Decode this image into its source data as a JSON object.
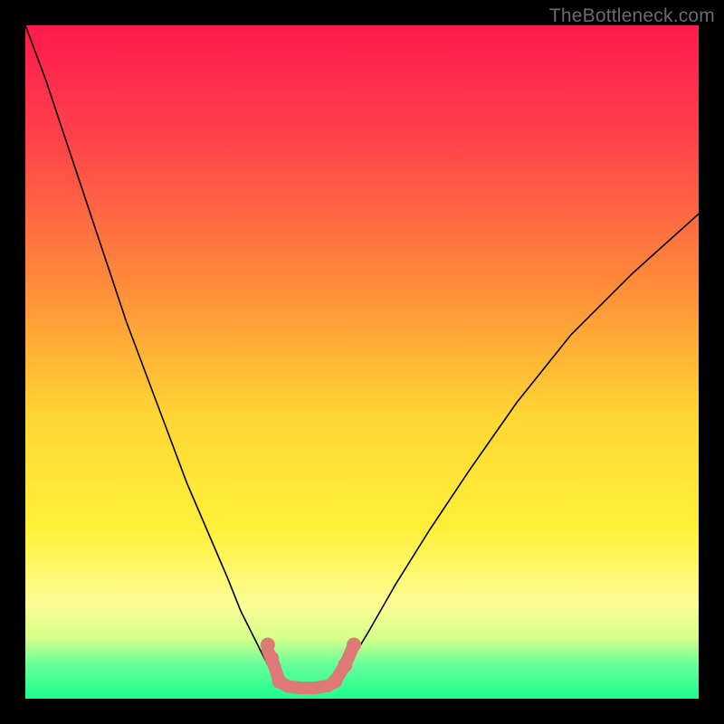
{
  "watermark": {
    "text": "TheBottleneck.com"
  },
  "chart_data": {
    "type": "line",
    "title": "",
    "xlabel": "",
    "ylabel": "",
    "xlim": [
      0,
      100
    ],
    "ylim": [
      0,
      100
    ],
    "grid": false,
    "legend": false,
    "background_gradient": {
      "stops": [
        {
          "pos": 0.0,
          "color": "#ff1a4d"
        },
        {
          "pos": 0.18,
          "color": "#ff454a"
        },
        {
          "pos": 0.38,
          "color": "#ff8a3a"
        },
        {
          "pos": 0.58,
          "color": "#ffd633"
        },
        {
          "pos": 0.75,
          "color": "#fff13a"
        },
        {
          "pos": 0.86,
          "color": "#fcfc95"
        },
        {
          "pos": 0.91,
          "color": "#d6ff8a"
        },
        {
          "pos": 0.95,
          "color": "#66ff99"
        },
        {
          "pos": 1.0,
          "color": "#1dff8f"
        }
      ]
    },
    "series": [
      {
        "name": "left-curve",
        "color": "#000000",
        "x": [
          0.0,
          3.0,
          6.0,
          9.0,
          12.0,
          15.0,
          18.0,
          21.0,
          24.0,
          27.0,
          30.0,
          32.0,
          34.0,
          36.0,
          37.7
        ],
        "y": [
          100.0,
          92.0,
          83.0,
          74.0,
          65.0,
          56.0,
          48.0,
          40.0,
          32.0,
          25.0,
          18.0,
          13.0,
          9.0,
          5.0,
          2.5
        ]
      },
      {
        "name": "right-curve",
        "color": "#000000",
        "x": [
          46.0,
          48.0,
          51.0,
          55.0,
          60.0,
          66.0,
          73.0,
          81.0,
          90.0,
          100.0
        ],
        "y": [
          2.5,
          5.0,
          10.0,
          17.0,
          25.0,
          34.0,
          44.0,
          54.0,
          63.0,
          72.0
        ]
      },
      {
        "name": "marker-band",
        "color": "#dd7a78",
        "stroke_width": 14,
        "x": [
          36.0,
          37.0,
          37.7,
          39.0,
          41.0,
          43.0,
          45.0,
          46.0,
          47.5,
          48.8
        ],
        "y": [
          7.2,
          4.8,
          2.6,
          1.8,
          1.6,
          1.6,
          1.9,
          2.6,
          5.0,
          8.0
        ]
      }
    ],
    "marker_dots": {
      "color": "#dd7a78",
      "radius": 8,
      "points": [
        {
          "x": 36.0,
          "y": 8.0
        },
        {
          "x": 36.6,
          "y": 6.0
        },
        {
          "x": 37.7,
          "y": 2.6
        },
        {
          "x": 46.0,
          "y": 2.6
        },
        {
          "x": 47.5,
          "y": 5.0
        },
        {
          "x": 48.8,
          "y": 8.0
        }
      ]
    }
  }
}
